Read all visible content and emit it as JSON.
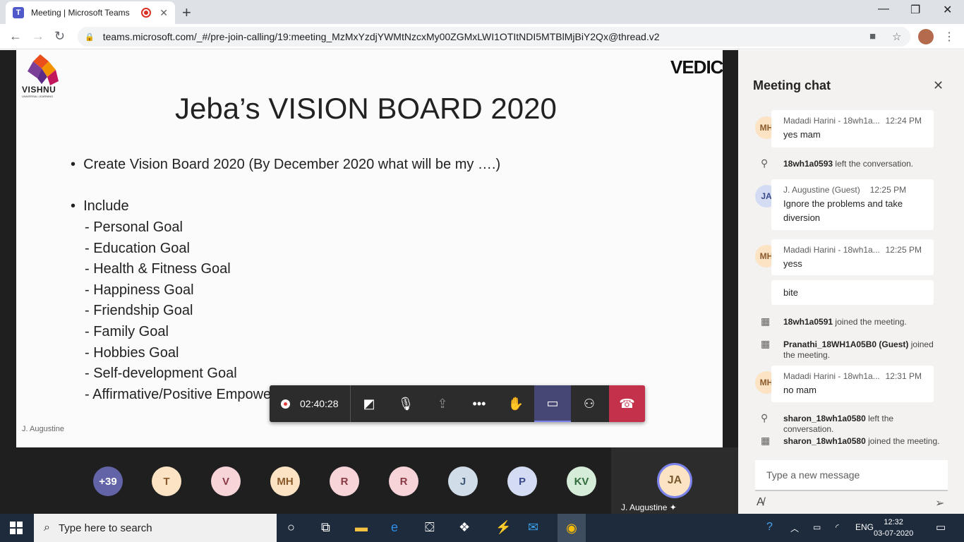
{
  "browser": {
    "tab_title": "Meeting | Microsoft Teams",
    "url": "teams.microsoft.com/_#/pre-join-calling/19:meeting_MzMxYzdjYWMtNzcxMy00ZGMxLWI1OTItNDI5MTBlMjBiY2Qx@thread.v2"
  },
  "slide": {
    "logo_text": "VISHNU",
    "logo_sub": "UNIVERSAL LEARNING",
    "brand": "VEDIC",
    "title": "Jeba’s VISION BOARD 2020",
    "bullets": [
      "Create Vision Board 2020 (By December 2020 what will be my ….)",
      "Include"
    ],
    "goals": [
      "- Personal Goal",
      "- Education Goal",
      "- Health & Fitness Goal",
      "- Happiness Goal",
      "- Friendship Goal",
      "- Family Goal",
      "- Hobbies Goal",
      "- Self-development Goal",
      "- Affirmative/Positive Empowering Statements or Phrases or Words to activate"
    ],
    "presenter": "J. Augustine"
  },
  "controls": {
    "timer": "02:40:28"
  },
  "participants": [
    {
      "initials": "+39",
      "bg": "#6264a7",
      "fg": "#ffffff"
    },
    {
      "initials": "T",
      "bg": "#fbe3c4",
      "fg": "#8a5a2b"
    },
    {
      "initials": "V",
      "bg": "#f6d4d8",
      "fg": "#8a3a44"
    },
    {
      "initials": "MH",
      "bg": "#fbe3c4",
      "fg": "#8a5a2b"
    },
    {
      "initials": "R",
      "bg": "#f6d4d8",
      "fg": "#8a3a44"
    },
    {
      "initials": "R",
      "bg": "#f6d4d8",
      "fg": "#8a3a44"
    },
    {
      "initials": "J",
      "bg": "#d0dce8",
      "fg": "#3b5a78"
    },
    {
      "initials": "P",
      "bg": "#d4dcf4",
      "fg": "#3a4a8a"
    },
    {
      "initials": "KV",
      "bg": "#d4ecd8",
      "fg": "#2f6b3a"
    }
  ],
  "self": {
    "initials": "JA",
    "name": "J. Augustine"
  },
  "chat": {
    "title": "Meeting chat",
    "messages": [
      {
        "initials": "MH",
        "sender": "Madadi Harini - 18wh1a...",
        "time": "12:24 PM",
        "text": "yes mam"
      },
      {
        "initials": "JA",
        "sender": "J. Augustine (Guest)",
        "time": "12:25 PM",
        "text": "Ignore the problems and take diversion"
      },
      {
        "initials": "MH",
        "sender": "Madadi Harini - 18wh1a...",
        "time": "12:25 PM",
        "text": "yess",
        "extra": "bite"
      },
      {
        "initials": "MH",
        "sender": "Madadi Harini - 18wh1a...",
        "time": "12:31 PM",
        "text": "no mam"
      }
    ],
    "events": [
      {
        "who": "18wh1a0593",
        "what": " left the conversation."
      },
      {
        "who": "18wh1a0591",
        "what": " joined the meeting."
      },
      {
        "who": "Pranathi_18WH1A05B0 (Guest)",
        "what": " joined the meeting."
      },
      {
        "who": "sharon_18wh1a0580",
        "what": " left the conversation."
      },
      {
        "who": "sharon_18wh1a0580",
        "what": " joined the meeting."
      }
    ],
    "compose_placeholder": "Type a new message"
  },
  "taskbar": {
    "search_placeholder": "Type here to search",
    "lang": "ENG",
    "time": "12:32",
    "date": "03-07-2020"
  },
  "colors": {
    "teams_purple": "#6264a7",
    "hangup_red": "#c4314b",
    "taskbar": "#1e2b3d"
  }
}
